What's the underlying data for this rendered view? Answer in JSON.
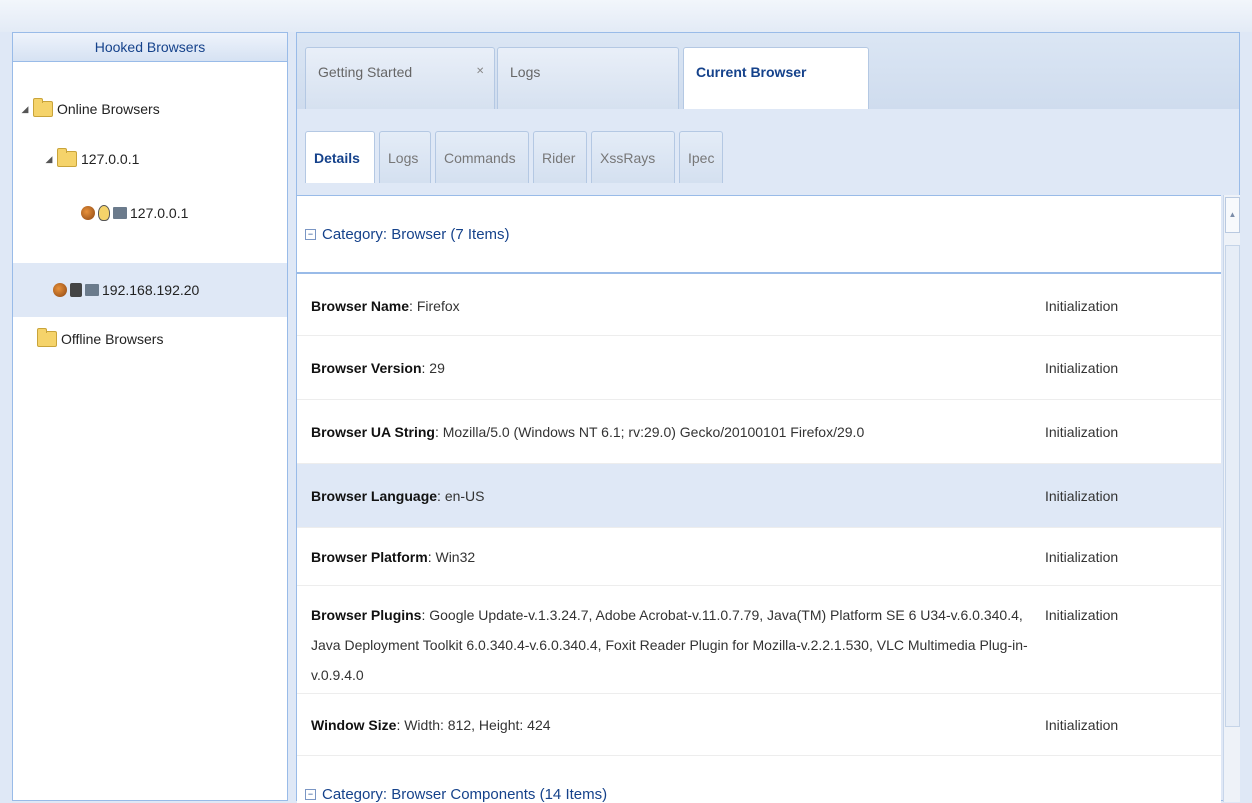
{
  "left_panel": {
    "title": "Hooked Browsers",
    "tree": {
      "online_label": "Online Browsers",
      "host_label": "127.0.0.1",
      "browser1_label": "127.0.0.1",
      "browser2_label": "192.168.192.20",
      "offline_label": "Offline Browsers"
    }
  },
  "main_tabs": [
    {
      "label": "Getting Started"
    },
    {
      "label": "Logs"
    },
    {
      "label": "Current Browser"
    }
  ],
  "sub_tabs": [
    {
      "label": "Details"
    },
    {
      "label": "Logs"
    },
    {
      "label": "Commands"
    },
    {
      "label": "Rider"
    },
    {
      "label": "XssRays"
    },
    {
      "label": "Ipec"
    }
  ],
  "details": {
    "group_header": "Category: Browser (7 Items)",
    "rows": [
      {
        "key": "Browser Name",
        "value": "Firefox",
        "source": "Initialization"
      },
      {
        "key": "Browser Version",
        "value": "29",
        "source": "Initialization"
      },
      {
        "key": "Browser UA String",
        "value": "Mozilla/5.0 (Windows NT 6.1; rv:29.0) Gecko/20100101 Firefox/29.0",
        "source": "Initialization"
      },
      {
        "key": "Browser Language",
        "value": "en-US",
        "source": "Initialization"
      },
      {
        "key": "Browser Platform",
        "value": "Win32",
        "source": "Initialization"
      },
      {
        "key": "Browser Plugins",
        "value": "Google Update-v.1.3.24.7, Adobe Acrobat-v.11.0.7.79, Java(TM) Platform SE 6 U34-v.6.0.340.4, Java Deployment Toolkit 6.0.340.4-v.6.0.340.4, Foxit Reader Plugin for Mozilla-v.2.2.1.530, VLC Multimedia Plug-in-v.0.9.4.0",
        "source": "Initialization"
      },
      {
        "key": "Window Size",
        "value": "Width: 812, Height: 424",
        "source": "Initialization"
      }
    ],
    "group2_header": "Category: Browser Components (14 Items)"
  },
  "colors": {
    "accent": "#15428b",
    "border": "#99bbe8",
    "selected_row": "#dfe8f6"
  }
}
